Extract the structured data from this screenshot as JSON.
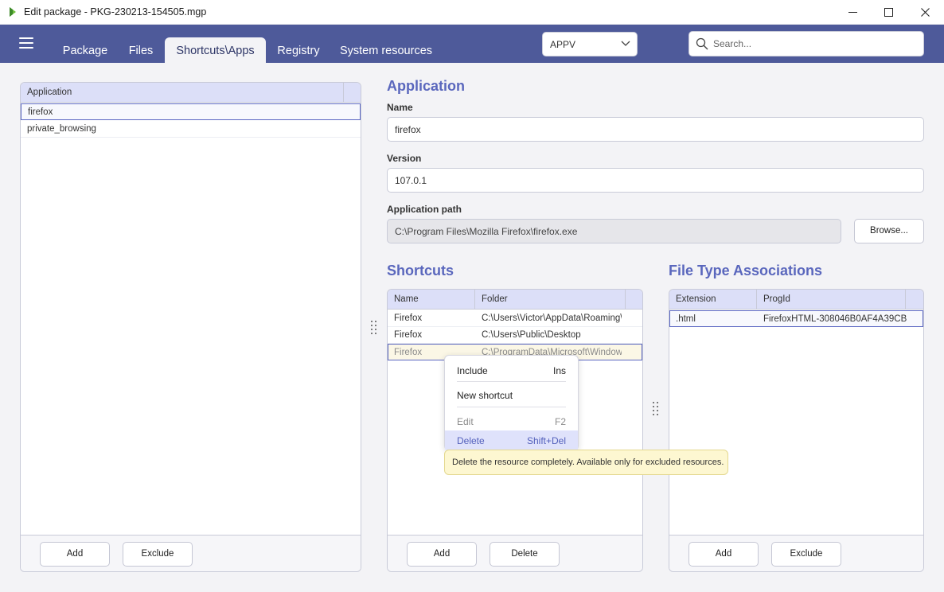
{
  "window": {
    "title": "Edit package - PKG-230213-154505.mgp"
  },
  "tabs": [
    {
      "label": "Package"
    },
    {
      "label": "Files"
    },
    {
      "label": "Shortcuts\\Apps"
    },
    {
      "label": "Registry"
    },
    {
      "label": "System resources"
    }
  ],
  "type_select": {
    "value": "APPV"
  },
  "search": {
    "placeholder": "Search..."
  },
  "applications": {
    "header": "Application",
    "rows": [
      "firefox",
      "private_browsing"
    ],
    "add_label": "Add",
    "exclude_label": "Exclude"
  },
  "application": {
    "title": "Application",
    "name_label": "Name",
    "name_value": "firefox",
    "version_label": "Version",
    "version_value": "107.0.1",
    "path_label": "Application path",
    "path_value": "C:\\Program Files\\Mozilla Firefox\\firefox.exe",
    "browse_label": "Browse..."
  },
  "shortcuts": {
    "title": "Shortcuts",
    "col_name": "Name",
    "col_folder": "Folder",
    "rows": [
      {
        "name": "Firefox",
        "folder": "C:\\Users\\Victor\\AppData\\Roaming\\Microsoft"
      },
      {
        "name": "Firefox",
        "folder": "C:\\Users\\Public\\Desktop"
      },
      {
        "name": "Firefox",
        "folder": "C:\\ProgramData\\Microsoft\\Windows"
      }
    ],
    "add_label": "Add",
    "delete_label": "Delete"
  },
  "fta": {
    "title": "File Type Associations",
    "col_ext": "Extension",
    "col_progid": "ProgId",
    "rows": [
      {
        "ext": ".html",
        "progid": "FirefoxHTML-308046B0AF4A39CB"
      }
    ],
    "add_label": "Add",
    "exclude_label": "Exclude"
  },
  "context_menu": {
    "include": {
      "label": "Include",
      "shortcut": "Ins"
    },
    "new_shortcut": {
      "label": "New shortcut"
    },
    "edit": {
      "label": "Edit",
      "shortcut": "F2"
    },
    "delete": {
      "label": "Delete",
      "shortcut": "Shift+Del"
    }
  },
  "tooltip": {
    "text": "Delete the resource completely. Available only for excluded resources."
  },
  "colors": {
    "header": "#4e5a9a",
    "accent": "#5a67bd",
    "grid_header": "#dcdff8",
    "tooltip": "#fdf7d1"
  }
}
